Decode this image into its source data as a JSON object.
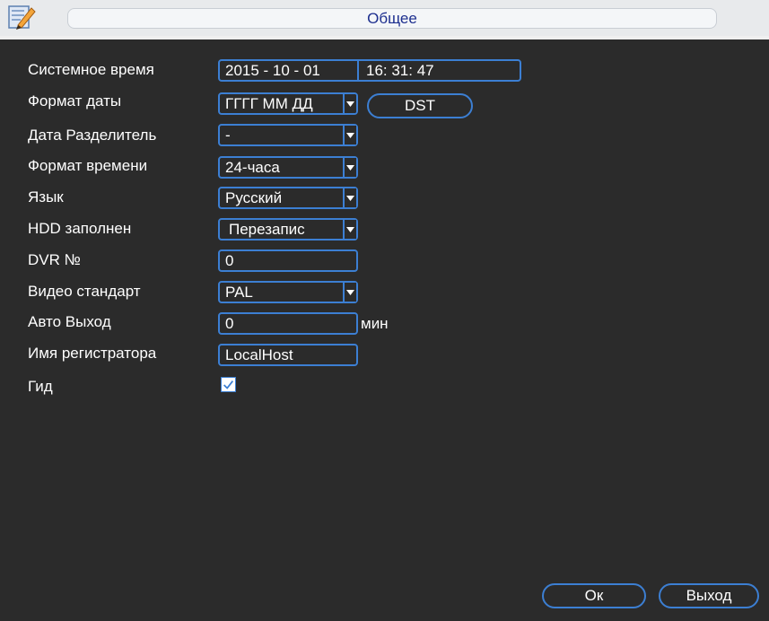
{
  "window": {
    "title": "Общее"
  },
  "fields": {
    "system_time": {
      "label": "Системное время",
      "date": "2015 - 10 - 01",
      "time": "16: 31: 47"
    },
    "date_format": {
      "label": "Формат даты",
      "value": "ГГГГ ММ ДД"
    },
    "dst_button": "DST",
    "date_separator": {
      "label": "Дата Разделитель",
      "value": "-"
    },
    "time_format": {
      "label": "Формат времени",
      "value": "24-часа"
    },
    "language": {
      "label": "Язык",
      "value": "Русский"
    },
    "hdd_full": {
      "label": "HDD заполнен",
      "value": "Перезапис"
    },
    "dvr_no": {
      "label": "DVR №",
      "value": "0"
    },
    "video_standard": {
      "label": "Видео стандарт",
      "value": "PAL"
    },
    "auto_logout": {
      "label": "Авто Выход",
      "value": "0",
      "unit": "мин"
    },
    "device_name": {
      "label": "Имя регистратора",
      "value": "LocalHost"
    },
    "guide": {
      "label": "Гид",
      "checked": true
    }
  },
  "buttons": {
    "ok": "Ок",
    "exit": "Выход"
  },
  "colors": {
    "accent": "#3c7fd3",
    "background": "#2b2b2b",
    "title_text": "#1d2f8f"
  }
}
